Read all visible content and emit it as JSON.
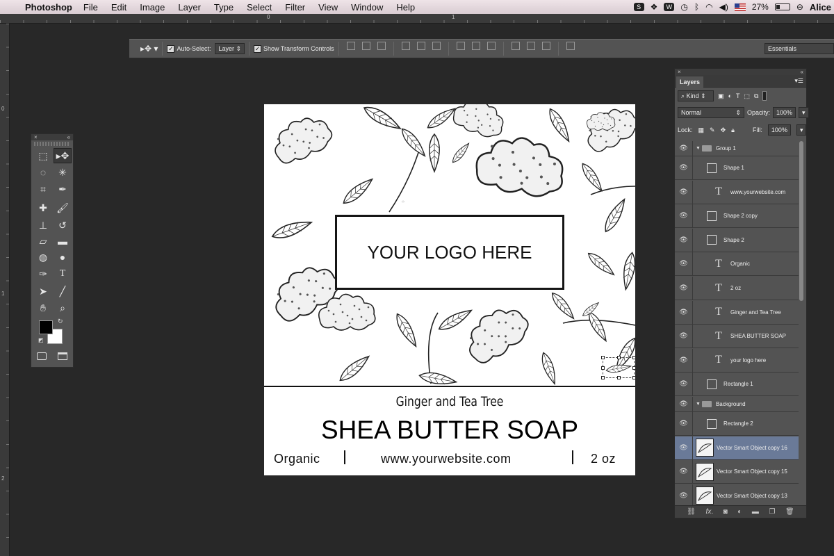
{
  "menubar": {
    "app": "Photoshop",
    "menus": [
      "File",
      "Edit",
      "Image",
      "Layer",
      "Type",
      "Select",
      "Filter",
      "View",
      "Window",
      "Help"
    ],
    "battery": "27%",
    "battery_level": 0.27,
    "user": "Alice"
  },
  "rulers": {
    "h_labels": [
      "0",
      "1"
    ],
    "v_labels": [
      "0",
      "1",
      "2"
    ]
  },
  "options": {
    "auto_select_label": "Auto-Select:",
    "auto_select_checked": true,
    "auto_select_value": "Layer",
    "transform_label": "Show Transform Controls",
    "transform_checked": true,
    "workspace": "Essentials"
  },
  "tools": [
    "rectangular-marquee",
    "move",
    "lasso",
    "magic-wand",
    "crop",
    "eyedropper",
    "healing-brush",
    "brush",
    "clone-stamp",
    "history-brush",
    "eraser",
    "gradient",
    "blur",
    "dodge",
    "pen",
    "type",
    "path-selection",
    "line",
    "hand",
    "zoom"
  ],
  "colors": {
    "foreground": "#000000",
    "background": "#ffffff",
    "selected_layer": "#6a7a98"
  },
  "label": {
    "logo": "YOUR LOGO HERE",
    "subtitle": "Ginger and Tea Tree",
    "title": "SHEA BUTTER SOAP",
    "left": "Organic",
    "center": "www.yourwebsite.com",
    "right": "2 oz"
  },
  "layers_panel": {
    "tab": "Layers",
    "filter": "Kind",
    "blend_mode": "Normal",
    "opacity_label": "Opacity:",
    "opacity": "100%",
    "lock_label": "Lock:",
    "fill_label": "Fill:",
    "fill": "100%",
    "layers": [
      {
        "name": "Group 1",
        "kind": "group",
        "expanded": true
      },
      {
        "name": "Shape 1",
        "kind": "shape"
      },
      {
        "name": "www.yourwebsite.com",
        "kind": "text"
      },
      {
        "name": "Shape 2 copy",
        "kind": "shape"
      },
      {
        "name": "Shape 2",
        "kind": "shape"
      },
      {
        "name": "Organic",
        "kind": "text"
      },
      {
        "name": "2 oz",
        "kind": "text"
      },
      {
        "name": "Ginger and Tea Tree",
        "kind": "text"
      },
      {
        "name": "SHEA BUTTER SOAP",
        "kind": "text"
      },
      {
        "name": "your logo here",
        "kind": "text"
      },
      {
        "name": "Rectangle 1",
        "kind": "shape"
      },
      {
        "name": "Background",
        "kind": "group",
        "expanded": true
      },
      {
        "name": "Rectangle 2",
        "kind": "shape"
      },
      {
        "name": "Vector Smart Object copy 16",
        "kind": "smart",
        "selected": true
      },
      {
        "name": "Vector Smart Object copy 15",
        "kind": "smart"
      },
      {
        "name": "Vector Smart Object copy 13",
        "kind": "smart"
      }
    ]
  }
}
